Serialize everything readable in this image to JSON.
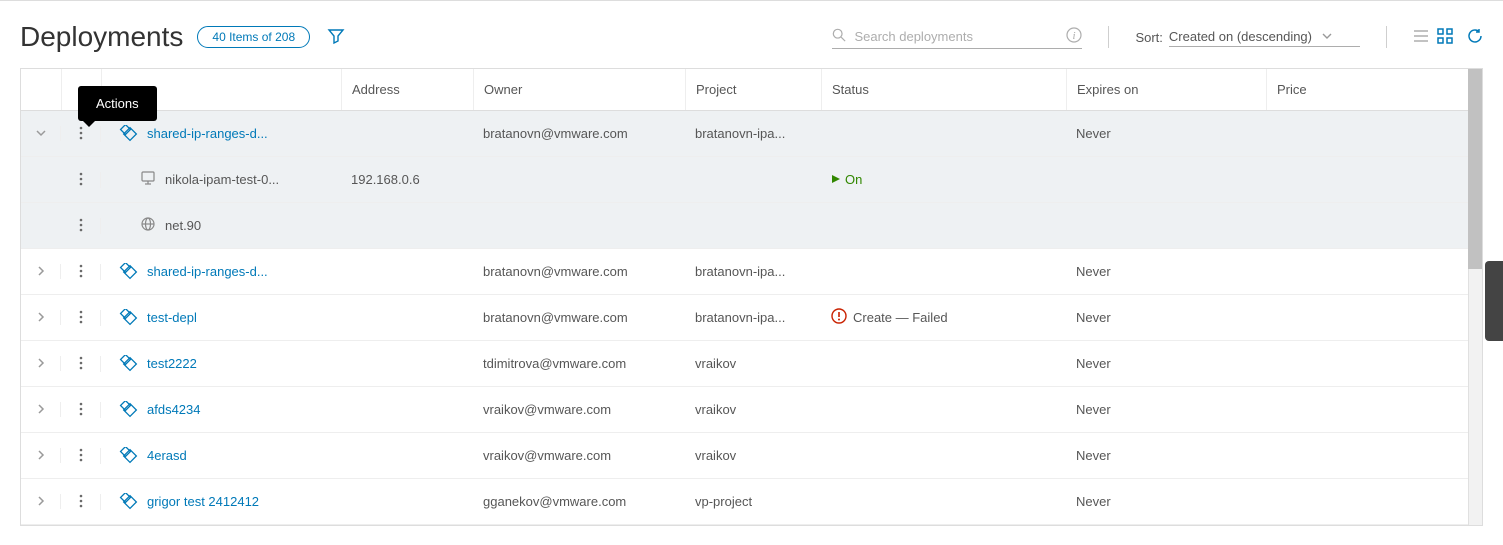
{
  "header": {
    "title": "Deployments",
    "count_pill": "40 Items of 208",
    "search_placeholder": "Search deployments",
    "sort_label": "Sort:",
    "sort_value": "Created on (descending)",
    "tooltip": "Actions"
  },
  "columns": {
    "address": "Address",
    "owner": "Owner",
    "project": "Project",
    "status": "Status",
    "expires": "Expires on",
    "price": "Price"
  },
  "rows": [
    {
      "expanded": true,
      "name": "shared-ip-ranges-d...",
      "owner": "bratanovn@vmware.com",
      "project": "bratanovn-ipa...",
      "expires": "Never",
      "children": [
        {
          "type": "vm",
          "name": "nikola-ipam-test-0...",
          "address": "192.168.0.6",
          "status": "On"
        },
        {
          "type": "net",
          "name": "net.90"
        }
      ]
    },
    {
      "expanded": false,
      "name": "shared-ip-ranges-d...",
      "owner": "bratanovn@vmware.com",
      "project": "bratanovn-ipa...",
      "expires": "Never"
    },
    {
      "expanded": false,
      "name": "test-depl",
      "owner": "bratanovn@vmware.com",
      "project": "bratanovn-ipa...",
      "status_err": "Create — Failed",
      "expires": "Never"
    },
    {
      "expanded": false,
      "name": "test2222",
      "owner": "tdimitrova@vmware.com",
      "project": "vraikov",
      "expires": "Never"
    },
    {
      "expanded": false,
      "name": "afds4234",
      "owner": "vraikov@vmware.com",
      "project": "vraikov",
      "expires": "Never"
    },
    {
      "expanded": false,
      "name": "4erasd",
      "owner": "vraikov@vmware.com",
      "project": "vraikov",
      "expires": "Never"
    },
    {
      "expanded": false,
      "name": "grigor test 2412412",
      "owner": "gganekov@vmware.com",
      "project": "vp-project",
      "expires": "Never"
    }
  ]
}
